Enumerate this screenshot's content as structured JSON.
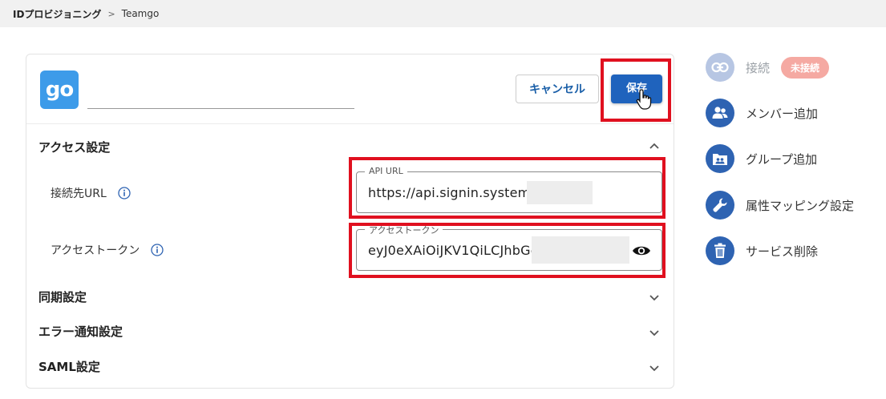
{
  "breadcrumb": {
    "root": "IDプロビジョニング",
    "separator": ">",
    "current": "Teamgo"
  },
  "app": {
    "logo_text": "go",
    "name_value": ""
  },
  "actions": {
    "cancel_label": "キャンセル",
    "save_label": "保存"
  },
  "access": {
    "title": "アクセス設定",
    "url_label": "接続先URL",
    "url_legend": "API URL",
    "url_value": "https://api.signin.systems",
    "token_label": "アクセストークン",
    "token_legend": "アクセストークン",
    "token_value": "eyJ0eXAiOiJKV1QiLCJhbGc"
  },
  "sections": {
    "sync": "同期設定",
    "error": "エラー通知設定",
    "saml": "SAML設定"
  },
  "sidebar": {
    "connect_label": "接続",
    "connect_status": "未接続",
    "add_member": "メンバー追加",
    "add_group": "グループ追加",
    "attr_mapping": "属性マッピング設定",
    "delete_service": "サービス削除"
  },
  "colors": {
    "primary": "#1f63bd",
    "highlight": "#e0101f",
    "badge": "#f5a9a2",
    "logo": "#3d9be9"
  }
}
